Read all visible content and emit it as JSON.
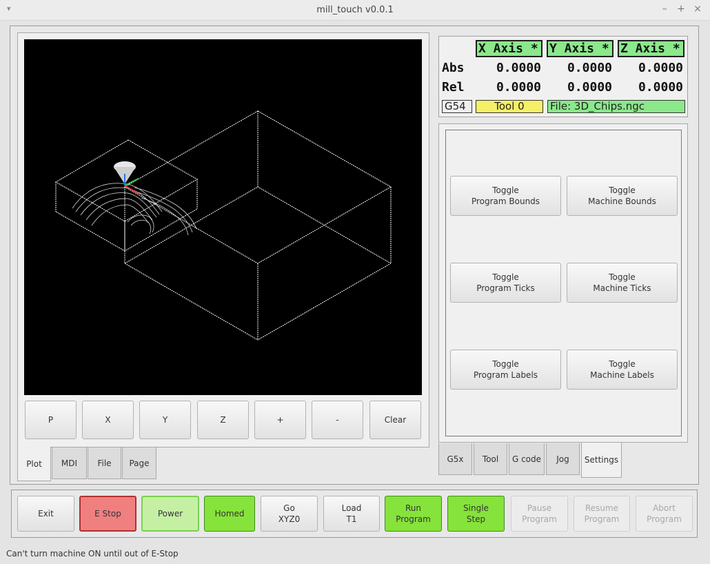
{
  "window": {
    "title": "mill_touch v0.0.1",
    "menu_glyph": "▾",
    "min_glyph": "–",
    "max_glyph": "+",
    "close_glyph": "×"
  },
  "plot_buttons": [
    "P",
    "X",
    "Y",
    "Z",
    "+",
    "-",
    "Clear"
  ],
  "left_tabs": [
    "Plot",
    "MDI",
    "File",
    "Page"
  ],
  "left_active_tab": "Plot",
  "dro": {
    "headers": [
      "X Axis *",
      "Y Axis *",
      "Z Axis *"
    ],
    "rows": [
      {
        "label": "Abs",
        "values": [
          "0.0000",
          "0.0000",
          "0.0000"
        ]
      },
      {
        "label": "Rel",
        "values": [
          "0.0000",
          "0.0000",
          "0.0000"
        ]
      }
    ],
    "work_offset": "G54",
    "tool": "Tool 0",
    "file": "File: 3D_Chips.ngc",
    "colors": {
      "axis_header": "#8be88b",
      "tool_bg": "#f5f066",
      "file_bg": "#8be88b"
    }
  },
  "settings_toggles": [
    [
      "Toggle",
      "Program Bounds"
    ],
    [
      "Toggle",
      "Machine Bounds"
    ],
    [
      "Toggle",
      "Program Ticks"
    ],
    [
      "Toggle",
      "Machine Ticks"
    ],
    [
      "Toggle",
      "Program Labels"
    ],
    [
      "Toggle",
      "Machine Labels"
    ]
  ],
  "right_tabs": [
    "G5x",
    "Tool",
    "G code",
    "Jog",
    "Settings"
  ],
  "right_active_tab": "Settings",
  "bottom_buttons": [
    {
      "lines": [
        "Exit"
      ],
      "state": "normal"
    },
    {
      "lines": [
        "E Stop"
      ],
      "state": "estop"
    },
    {
      "lines": [
        "Power"
      ],
      "state": "power"
    },
    {
      "lines": [
        "Homed"
      ],
      "state": "green"
    },
    {
      "lines": [
        "Go",
        "XYZ0"
      ],
      "state": "normal"
    },
    {
      "lines": [
        "Load",
        "T1"
      ],
      "state": "normal"
    },
    {
      "lines": [
        "Run",
        "Program"
      ],
      "state": "green"
    },
    {
      "lines": [
        "Single",
        "Step"
      ],
      "state": "green"
    },
    {
      "lines": [
        "Pause",
        "Program"
      ],
      "state": "disabled"
    },
    {
      "lines": [
        "Resume",
        "Program"
      ],
      "state": "disabled"
    },
    {
      "lines": [
        "Abort",
        "Program"
      ],
      "state": "disabled"
    }
  ],
  "status_message": "Can't turn machine ON until out of E-Stop",
  "colors": {
    "green_button": "#86e33b",
    "estop_button": "#f08080",
    "power_button": "#c5f0a4"
  }
}
